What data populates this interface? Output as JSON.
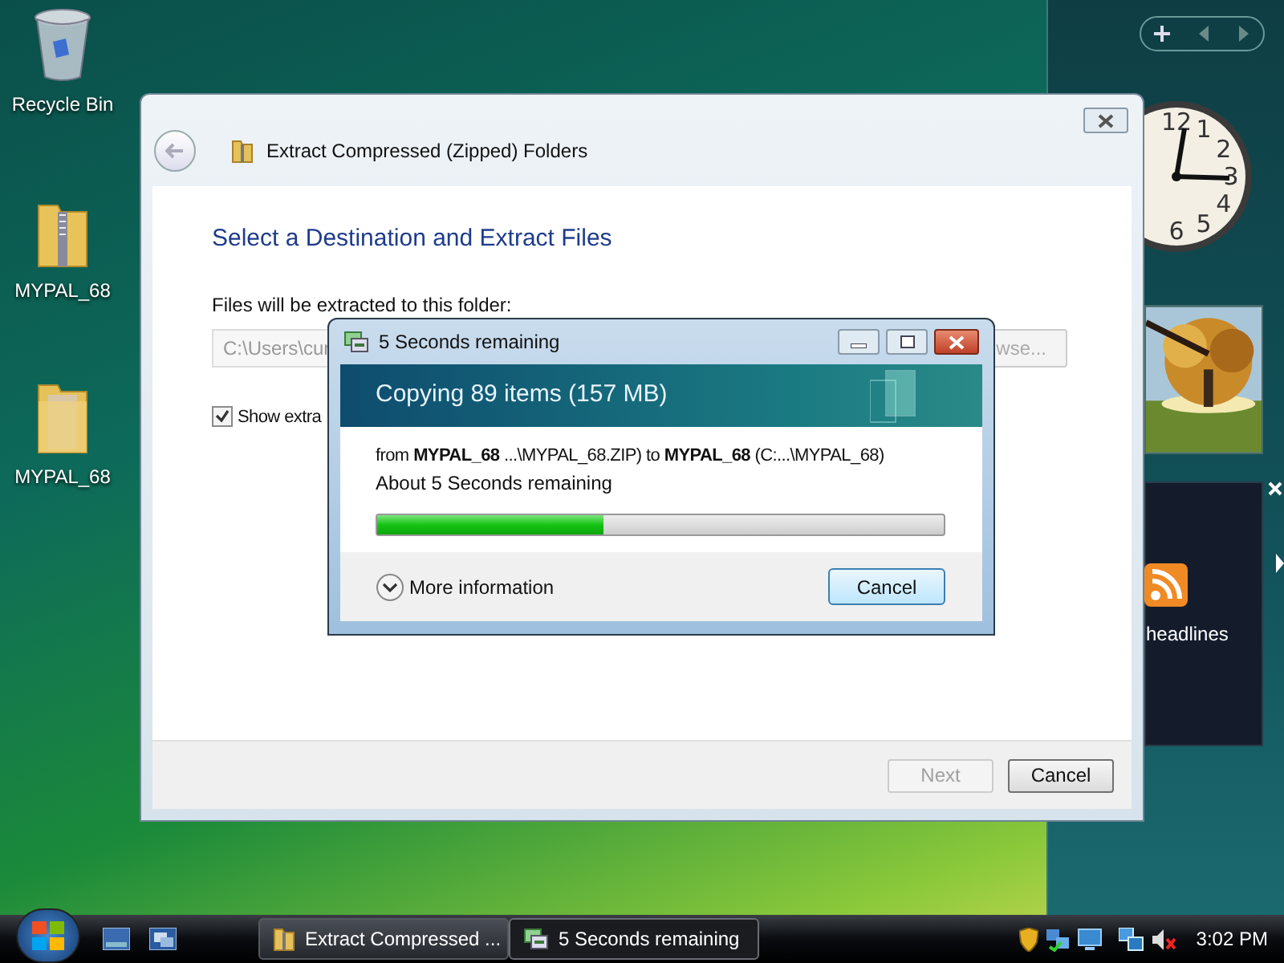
{
  "desktop_icons": [
    {
      "label": "Recycle Bin",
      "kind": "bin"
    },
    {
      "label": "MYPAL_68",
      "kind": "zip"
    },
    {
      "label": "MYPAL_68",
      "kind": "folder"
    }
  ],
  "sidebar": {
    "clock_numerals": [
      "12",
      "1",
      "2",
      "3",
      "4",
      "5",
      "6"
    ],
    "feed_label": "headlines"
  },
  "extract_window": {
    "title": "Extract Compressed (Zipped) Folders",
    "heading": "Select a Destination and Extract Files",
    "folder_label": "Files will be extracted to this folder:",
    "folder_value": "C:\\Users\\cur",
    "browse_button": "wse...",
    "show_checkbox": {
      "label": "Show extra",
      "checked": true
    },
    "buttons": [
      {
        "label": "Next",
        "disabled": true
      },
      {
        "label": "Cancel",
        "disabled": false
      }
    ]
  },
  "progress_window": {
    "title": "5 Seconds remaining",
    "header": "Copying 89 items (157 MB)",
    "detail": "from **MYPAL_68** ...\\MYPAL_68.ZIP) to **MYPAL_68** (C:...\\MYPAL_68)",
    "time_left": "About 5 Seconds remaining",
    "level": 0.4,
    "more_info": "More information",
    "cancel": "Cancel"
  },
  "taskbar": {
    "tasks": [
      {
        "label": "Extract Compressed ...",
        "kind": "folder",
        "selected": false
      },
      {
        "label": "5 Seconds remaining",
        "kind": "copy",
        "selected": true
      }
    ],
    "time": "3:02 PM"
  }
}
